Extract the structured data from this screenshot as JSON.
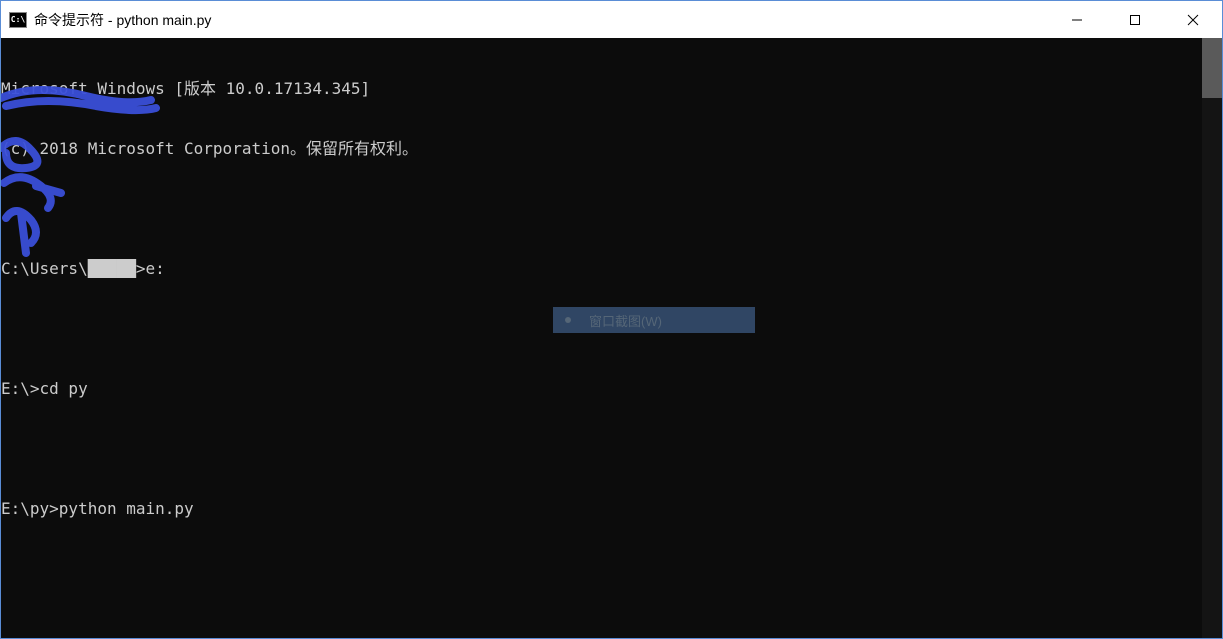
{
  "window": {
    "title": "命令提示符 - python  main.py",
    "icon_label": "C:\\"
  },
  "terminal": {
    "lines": [
      "Microsoft Windows [版本 10.0.17134.345]",
      "(c) 2018 Microsoft Corporation。保留所有权利。",
      "",
      "C:\\Users\\█████>e:",
      "",
      "E:\\>cd py",
      "",
      "E:\\py>python main.py",
      ""
    ]
  },
  "overlay": {
    "tooltip": "窗口截图(W)"
  },
  "colors": {
    "terminal_bg": "#0c0c0c",
    "terminal_fg": "#cccccc",
    "scribble": "#3a4fd8"
  }
}
